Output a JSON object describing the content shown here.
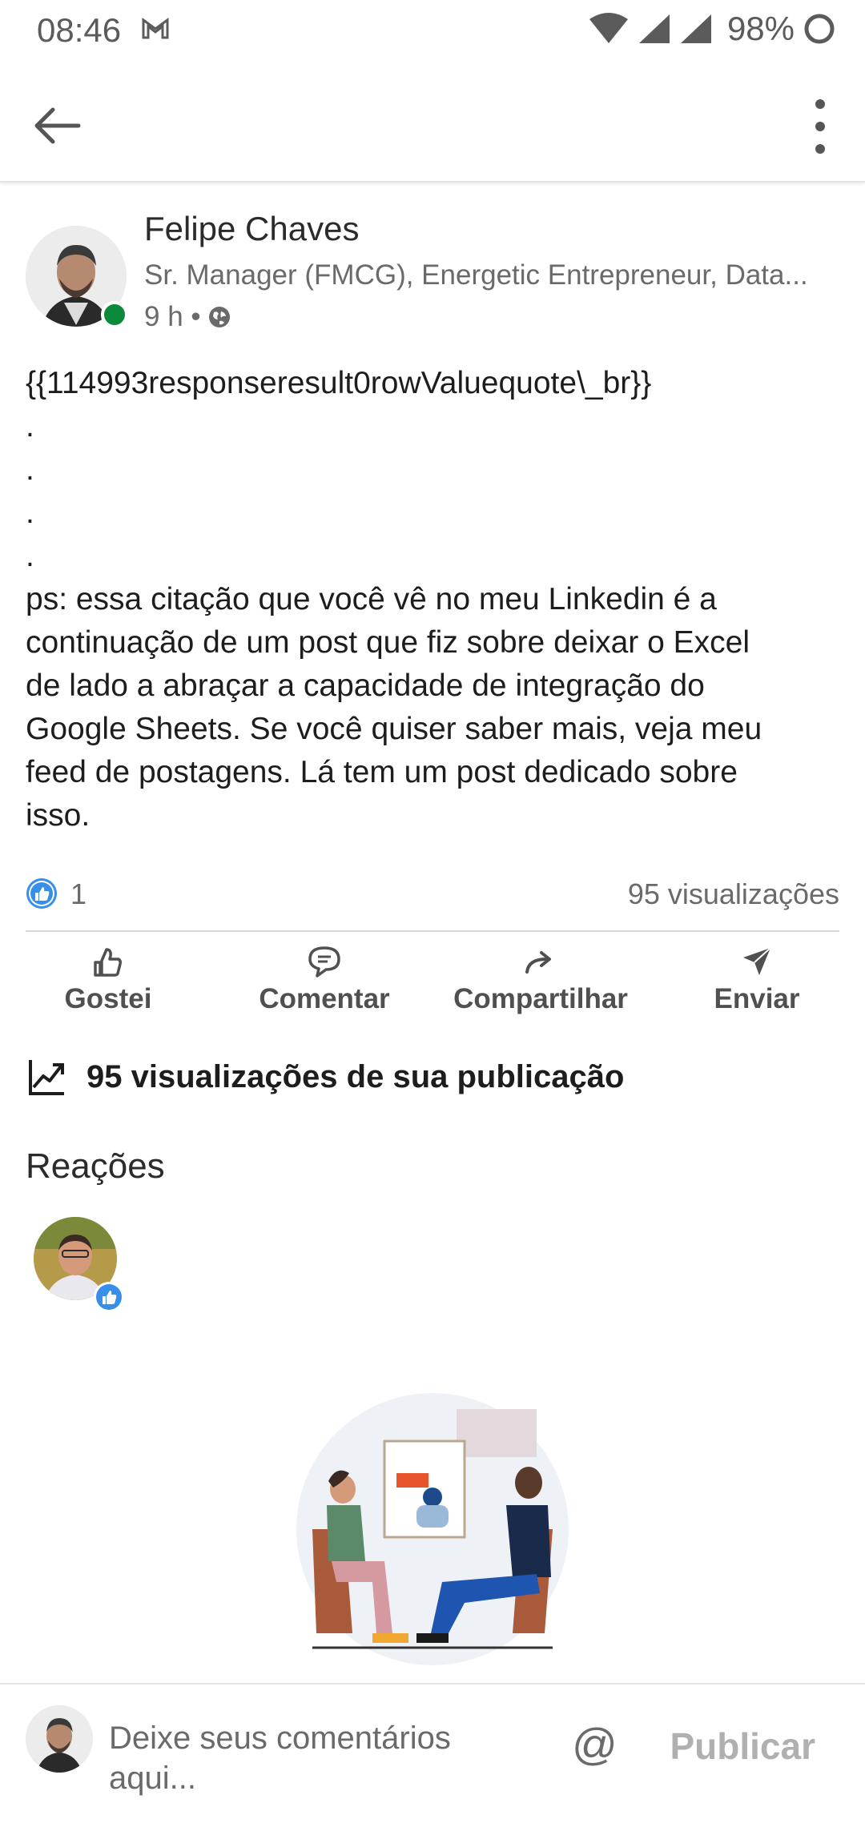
{
  "status_bar": {
    "time": "08:46",
    "battery": "98%"
  },
  "appbar": {
    "back_icon": "arrow-left-icon",
    "more_icon": "more-vertical-icon"
  },
  "post": {
    "author_name": "Felipe Chaves",
    "author_headline": "Sr. Manager (FMCG), Energetic Entrepreneur, Data...",
    "time": "9 h •",
    "visibility_icon": "globe-icon",
    "body_lines": [
      "{{114993responseresult0rowValuequote\\_br}}",
      ".",
      ".",
      ".",
      ".",
      "ps: essa citação que você vê no meu Linkedin é a",
      "continuação de um post que fiz sobre deixar o Excel",
      "de lado a abraçar a capacidade de integração do",
      "Google Sheets. Se você quiser saber mais, veja meu",
      "feed de postagens. Lá tem um post dedicado sobre",
      "isso."
    ],
    "like_count": "1",
    "views": "95 visualizações"
  },
  "actions": [
    {
      "label": "Gostei",
      "icon": "thumbs-up-icon"
    },
    {
      "label": "Comentar",
      "icon": "comment-icon"
    },
    {
      "label": "Compartilhar",
      "icon": "share-icon"
    },
    {
      "label": "Enviar",
      "icon": "send-icon"
    }
  ],
  "impressions": {
    "text": "95 visualizações de sua publicação",
    "icon": "trending-chart-icon"
  },
  "reactions": {
    "title": "Reações"
  },
  "composer": {
    "placeholder": "Deixe seus comentários aqui...",
    "at_symbol": "@",
    "publish_label": "Publicar"
  },
  "colors": {
    "like_blue": "#378fe9",
    "online_green": "#0a8a3a",
    "text": "#1d1d1d",
    "muted": "#6a6a6a"
  }
}
